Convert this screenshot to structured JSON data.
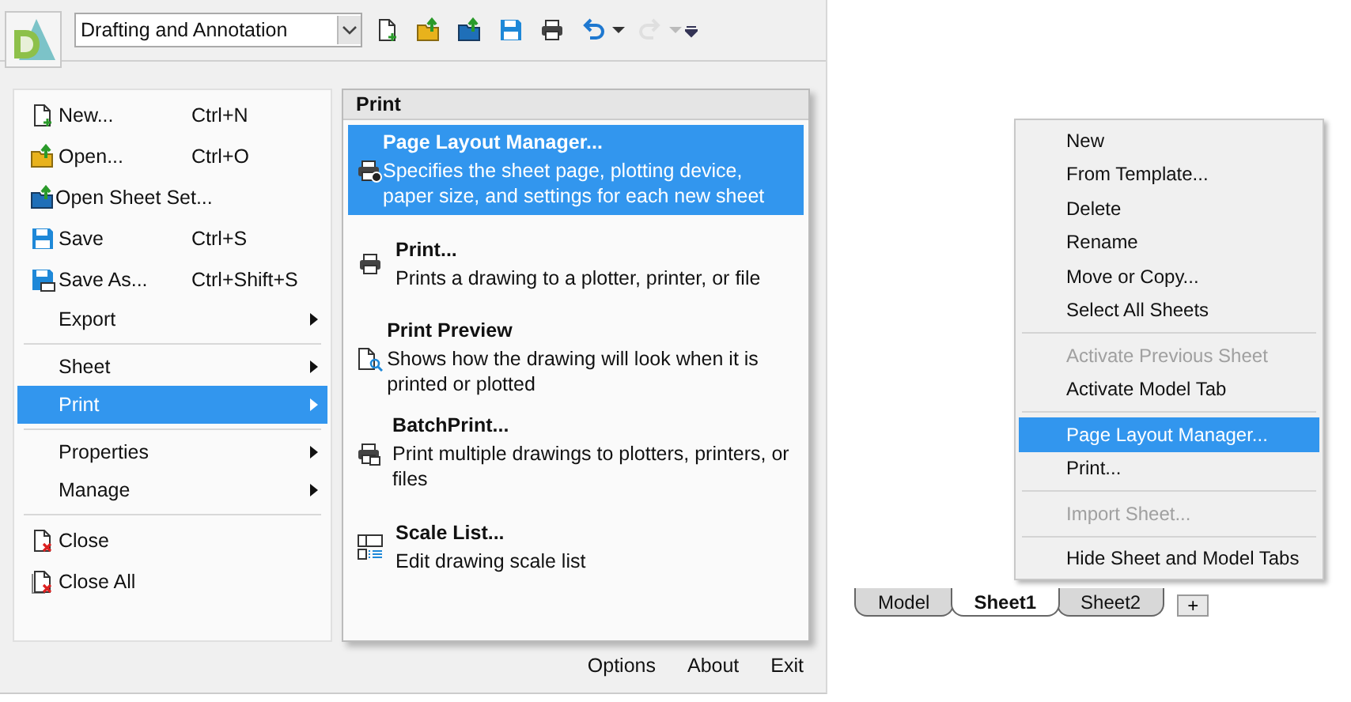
{
  "toolbar": {
    "workspace": "Drafting and Annotation",
    "buttons": [
      {
        "kind": "new",
        "disabled": false
      },
      {
        "kind": "open",
        "disabled": false
      },
      {
        "kind": "sheetset",
        "disabled": false
      },
      {
        "kind": "save",
        "disabled": false
      },
      {
        "kind": "printer",
        "disabled": false
      },
      {
        "kind": "undo",
        "disabled": false
      },
      {
        "kind": "redo",
        "disabled": true
      }
    ]
  },
  "app_menu": {
    "groups": [
      [
        {
          "label": "New...",
          "kind": "new",
          "shortcut": "Ctrl+N",
          "submenu": false,
          "selected": false
        },
        {
          "label": "Open...",
          "kind": "open",
          "shortcut": "Ctrl+O",
          "submenu": false,
          "selected": false
        },
        {
          "label": "Open Sheet Set...",
          "kind": "sheetset",
          "submenu": false,
          "selected": false
        },
        {
          "label": "Save",
          "kind": "save",
          "shortcut": "Ctrl+S",
          "submenu": false,
          "selected": false
        },
        {
          "label": "Save As...",
          "kind": "saveas",
          "shortcut": "Ctrl+Shift+S",
          "submenu": false,
          "selected": false
        },
        {
          "label": "Export",
          "submenu": true,
          "selected": false
        }
      ],
      [
        {
          "label": "Sheet",
          "submenu": true,
          "selected": false
        },
        {
          "label": "Print",
          "submenu": true,
          "selected": true
        }
      ],
      [
        {
          "label": "Properties",
          "submenu": true,
          "selected": false
        },
        {
          "label": "Manage",
          "submenu": true,
          "selected": false
        }
      ],
      [
        {
          "label": "Close",
          "kind": "close",
          "submenu": false,
          "selected": false
        },
        {
          "label": "Close All",
          "kind": "closeall",
          "submenu": false,
          "selected": false
        }
      ]
    ],
    "submenu": {
      "title": "Print",
      "items": [
        {
          "label": "Page Layout Manager...",
          "description": "Specifies the sheet page, plotting device, paper size, and settings for each new sheet",
          "kind": "pagesetup",
          "selected": true
        },
        {
          "label": "Print...",
          "description": "Prints a drawing to a plotter, printer, or file",
          "kind": "printer",
          "selected": false
        },
        {
          "label": "Print Preview",
          "description": "Shows how the drawing will look when it is printed or plotted",
          "kind": "preview",
          "selected": false
        },
        {
          "label": "BatchPrint...",
          "description": "Print multiple drawings to plotters, printers, or files",
          "kind": "batch",
          "selected": false
        },
        {
          "label": "Scale List...",
          "description": "Edit drawing scale list",
          "kind": "scale",
          "selected": false
        }
      ]
    },
    "footer_buttons": [
      "Options",
      "About",
      "Exit"
    ]
  },
  "context_menu": {
    "groups": [
      [
        {
          "label": "New",
          "disabled": false,
          "selected": false
        },
        {
          "label": "From Template...",
          "disabled": false,
          "selected": false
        },
        {
          "label": "Delete",
          "disabled": false,
          "selected": false
        },
        {
          "label": "Rename",
          "disabled": false,
          "selected": false
        },
        {
          "label": "Move or Copy...",
          "disabled": false,
          "selected": false
        },
        {
          "label": "Select All Sheets",
          "disabled": false,
          "selected": false
        }
      ],
      [
        {
          "label": "Activate Previous Sheet",
          "disabled": true,
          "selected": false
        },
        {
          "label": "Activate Model Tab",
          "disabled": false,
          "selected": false
        }
      ],
      [
        {
          "label": "Page Layout Manager...",
          "disabled": false,
          "selected": true
        },
        {
          "label": "Print...",
          "disabled": false,
          "selected": false
        }
      ],
      [
        {
          "label": "Import Sheet...",
          "disabled": true,
          "selected": false
        }
      ],
      [
        {
          "label": "Hide Sheet and Model Tabs",
          "disabled": false,
          "selected": false
        }
      ]
    ]
  },
  "sheet_tabs": [
    {
      "label": "Model",
      "selected": false
    },
    {
      "label": "Sheet1",
      "selected": true
    },
    {
      "label": "Sheet2",
      "selected": false
    }
  ],
  "add_tab": "+"
}
